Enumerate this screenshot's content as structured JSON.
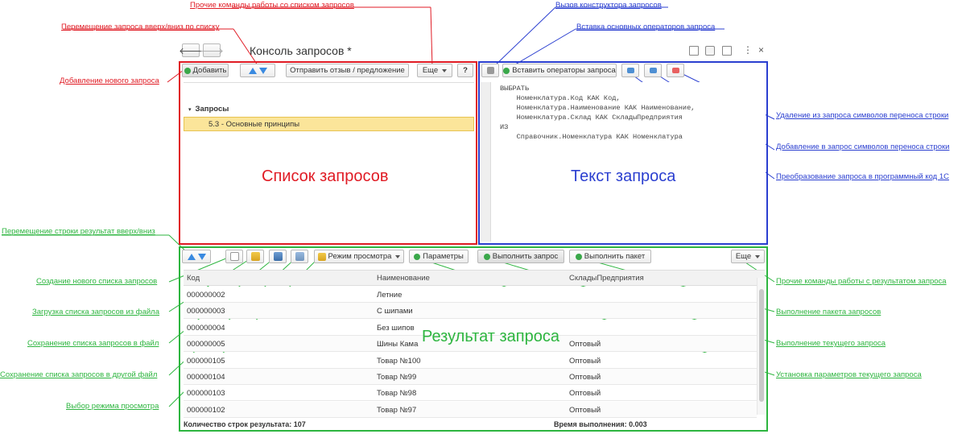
{
  "window": {
    "title": "Консоль запросов *",
    "back_icon": "arrow-left-icon",
    "forward_icon": "arrow-right-icon"
  },
  "queries_toolbar": {
    "add_label": "Добавить",
    "feedback_label": "Отправить отзыв / предложение",
    "more_label": "Еще",
    "help_label": "?"
  },
  "query_text_toolbar": {
    "insert_operators_label": "Вставить операторы запроса"
  },
  "tree": {
    "group_label": "Запросы",
    "selected_item": "5.3 - Основные принципы"
  },
  "code_lines": [
    "ВЫБРАТЬ",
    "    Номенклатура.Код КАК Код,",
    "    Номенклатура.Наименование КАК Наименование,",
    "    Номенклатура.Склад КАК СкладыПредприятия",
    "ИЗ",
    "    Справочник.Номенклатура КАК Номенклатура"
  ],
  "result_toolbar": {
    "view_mode_label": "Режим просмотра",
    "params_label": "Параметры",
    "execute_label": "Выполнить запрос",
    "execute_batch_label": "Выполнить пакет",
    "more_label": "Еще"
  },
  "table": {
    "columns": [
      "Код",
      "Наименование",
      "СкладыПредприятия"
    ],
    "rows": [
      [
        "000000002",
        "Летние",
        ""
      ],
      [
        "000000003",
        "С шипами",
        ""
      ],
      [
        "000000004",
        "Без шипов",
        ""
      ],
      [
        "000000005",
        "Шины Кама",
        "Оптовый"
      ],
      [
        "000000105",
        "Товар №100",
        "Оптовый"
      ],
      [
        "000000104",
        "Товар №99",
        "Оптовый"
      ],
      [
        "000000103",
        "Товар №98",
        "Оптовый"
      ],
      [
        "000000102",
        "Товар №97",
        "Оптовый"
      ]
    ]
  },
  "footer": {
    "row_count": "Количество строк результата: 107",
    "exec_time": "Время выполнения: 0.003"
  },
  "section_labels": {
    "list": "Список запросов",
    "text": "Текст запроса",
    "result": "Результат запроса"
  },
  "annotations": {
    "other_list_commands": "Прочие команды работы со списком запросов",
    "move_query": "Перемещение запроса вверх/вниз по списку",
    "add_query": "Добавление нового запроса",
    "call_constructor": "Вызов конструктора запросов",
    "insert_operators": "Вставка основных операторов запроса",
    "remove_linebreaks": "Удаление из запроса символов переноса строки",
    "add_linebreaks": "Добавление в запрос символов переноса строки",
    "to_program_code": "Преобразование запроса в программный код 1С",
    "move_result_row": "Перемещение строки результат вверх/вниз",
    "new_list": "Создание нового списка запросов",
    "load_list": "Загрузка списка запросов из файла",
    "save_list": "Сохранение списка запросов в файл",
    "save_list_other": "Сохранение списка запросов в другой файл",
    "view_mode": "Выбор режима просмотра",
    "other_result_commands": "Прочие команды работы с результатом запроса",
    "exec_batch": "Выполнение пакета запросов",
    "exec_current": "Выполнение текущего запроса",
    "set_params": "Установка параметров текущего запроса"
  },
  "colors": {
    "red": "#e01b24",
    "blue": "#2b3fd0",
    "green": "#2db53f",
    "selection": "#fbe59a"
  }
}
